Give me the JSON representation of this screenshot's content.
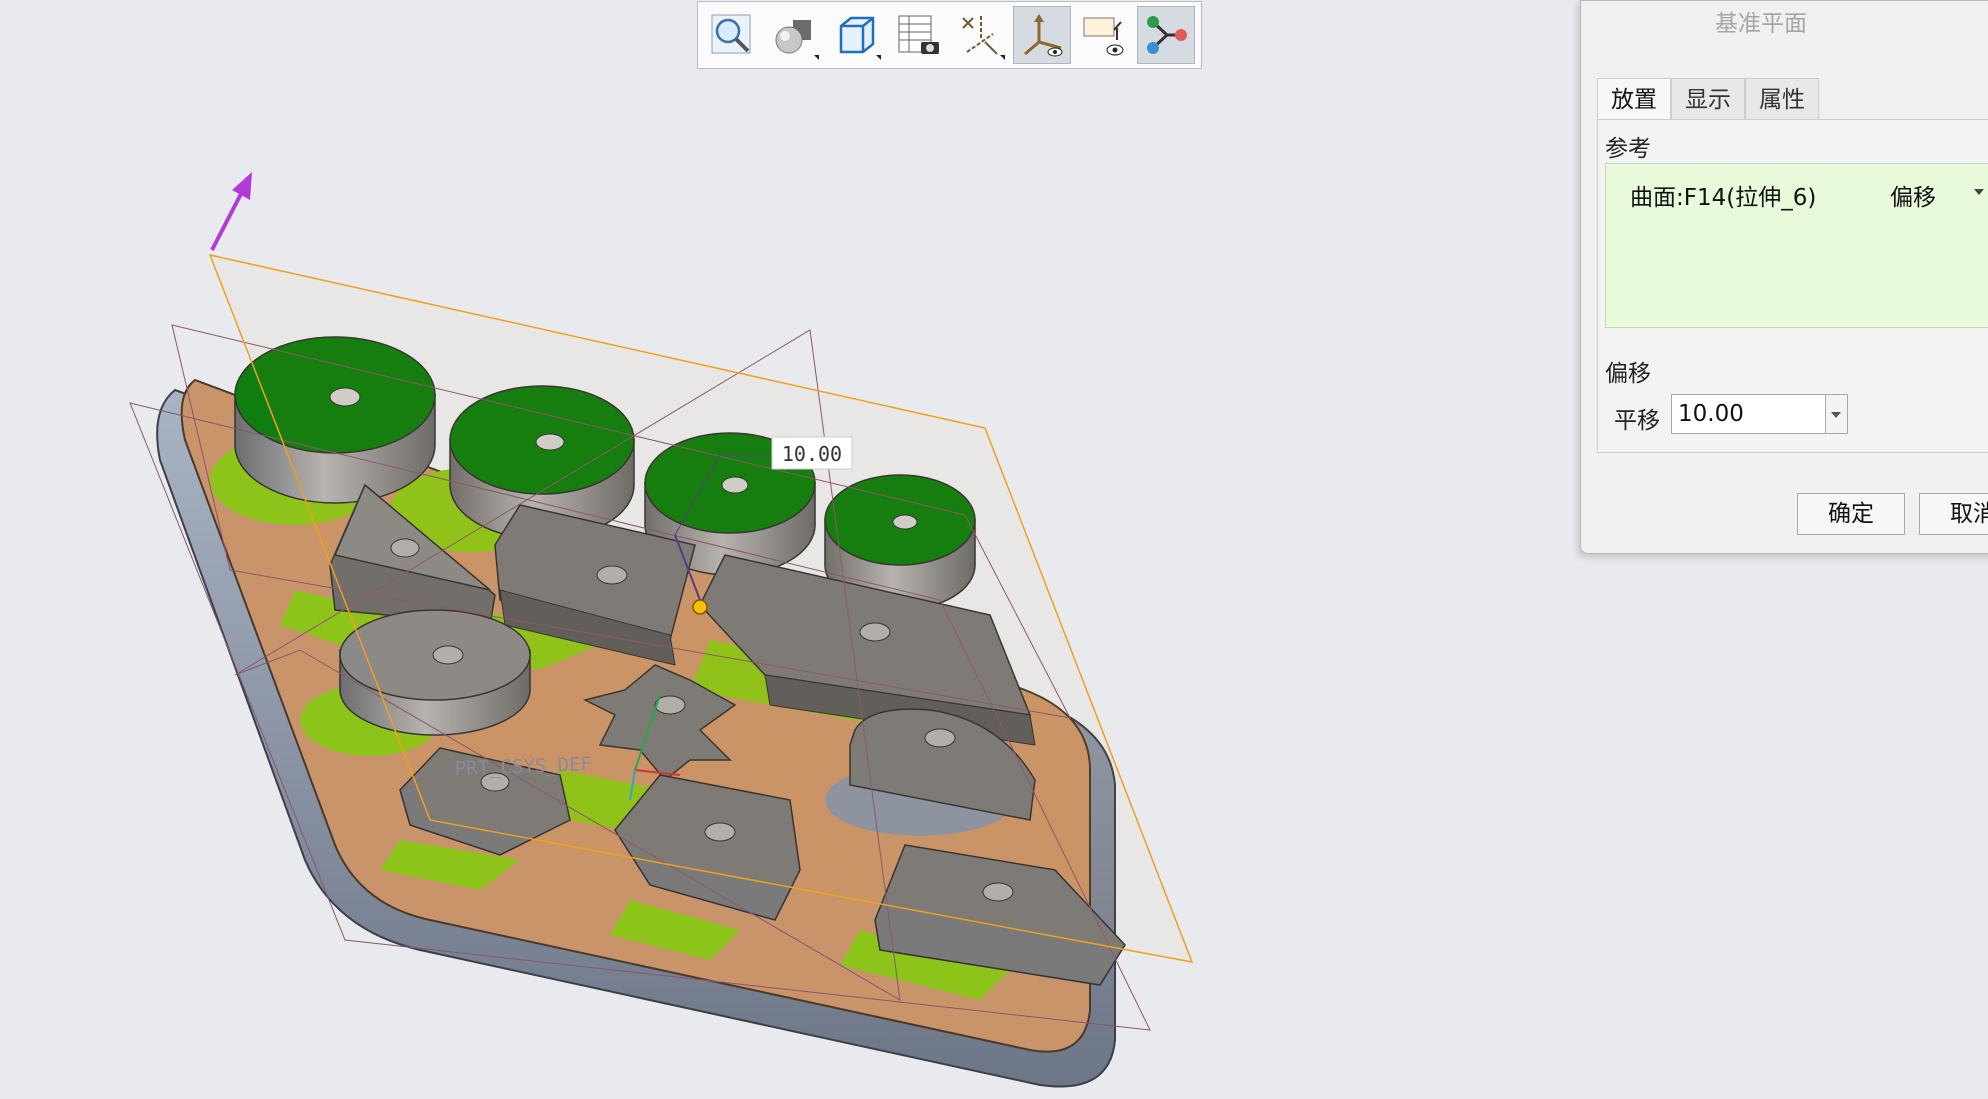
{
  "viewport": {
    "dimension_label": "10.00",
    "csys_label": "PRT_CSYS_DEF"
  },
  "toolbar": {
    "buttons": [
      {
        "icon": "zoom-icon"
      },
      {
        "icon": "display-style-icon"
      },
      {
        "icon": "saved-views-icon"
      },
      {
        "icon": "view-manager-icon"
      },
      {
        "icon": "datum-display-icon"
      },
      {
        "icon": "csys-display-icon"
      },
      {
        "icon": "annotation-display-icon"
      },
      {
        "icon": "spin-center-icon"
      }
    ]
  },
  "dialog": {
    "title": "基准平面",
    "tabs": [
      {
        "label": "放置",
        "active": true
      },
      {
        "label": "显示",
        "active": false
      },
      {
        "label": "属性",
        "active": false
      }
    ],
    "references_label": "参考",
    "reference_item": {
      "surface": "曲面:F14(拉伸_6)",
      "constraint": "偏移"
    },
    "offset_label": "偏移",
    "translate_label": "平移",
    "translate_value": "10.00",
    "ok_label": "确定",
    "cancel_label": "取消"
  },
  "colors": {
    "part_grey": "#7e7e7e",
    "top_face_green": "#0f7d0f",
    "base_orange": "#c9946a",
    "pocket_lime": "#8dc41a",
    "datum_plane_orange": "#f0a020",
    "arrow_purple": "#b23ad6"
  }
}
